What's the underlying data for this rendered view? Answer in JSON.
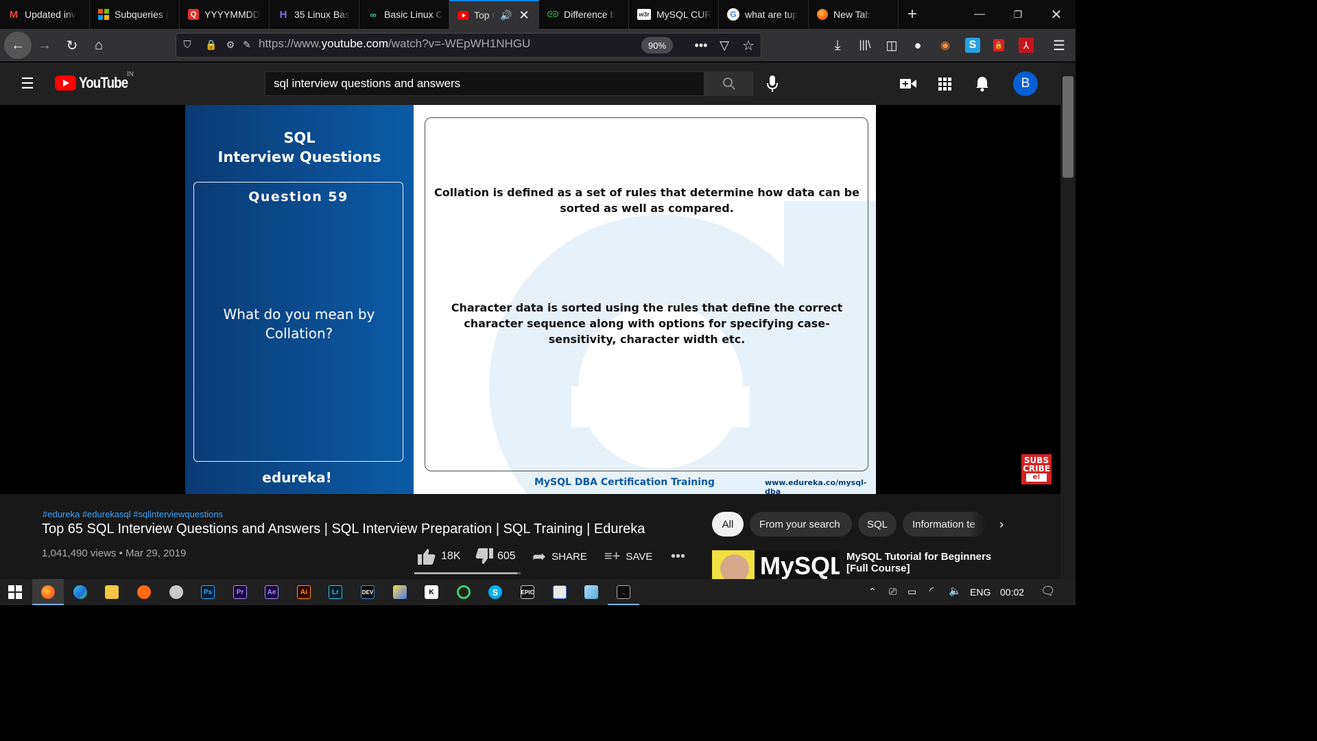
{
  "browser": {
    "tabs": [
      {
        "label": "Updated inv",
        "icon": "gmail-icon",
        "active": false
      },
      {
        "label": "Subqueries (",
        "icon": "microsoft-icon",
        "active": false
      },
      {
        "label": "YYYYMMDD",
        "icon": "page-icon",
        "active": false
      },
      {
        "label": "35 Linux Bas",
        "icon": "site-icon",
        "active": false
      },
      {
        "label": "Basic Linux C",
        "icon": "site-icon",
        "active": false
      },
      {
        "label": "Top 6",
        "icon": "youtube-icon",
        "active": true
      },
      {
        "label": "Difference b",
        "icon": "gfg-icon",
        "active": false
      },
      {
        "label": "MySQL CUR",
        "icon": "w3schools-icon",
        "active": false
      },
      {
        "label": "what are tup",
        "icon": "google-icon",
        "active": false
      },
      {
        "label": "New Tab",
        "icon": "firefox-icon",
        "active": false
      }
    ],
    "url_prefix": "https://www.",
    "url_domain": "youtube.com",
    "url_path": "/watch?v=-WEpWH1NHGU",
    "zoom": "90%"
  },
  "youtube": {
    "logo_text": "YouTube",
    "region": "IN",
    "search_value": "sql interview questions and answers",
    "avatar_letter": "B"
  },
  "slide": {
    "left_title_1": "SQL",
    "left_title_2": "Interview Questions",
    "question_label": "Question 59",
    "question_text": "What do you mean by Collation?",
    "brand": "edureka!",
    "answer_1": "Collation is defined as a set of rules that determine how data can be sorted as well as compared.",
    "answer_2": "Character data is sorted using the rules that define the correct character sequence along with options for specifying case-sensitivity, character width etc.",
    "footer_course": "MySQL DBA Certification Training",
    "footer_url": "www.edureka.co/mysql-dba",
    "subscribe_1": "SUBS",
    "subscribe_2": "CRIBE",
    "subscribe_3": "e!"
  },
  "video": {
    "hashtags": "#edureka #edurekasql #sqlinterviewquestions",
    "title": "Top 65 SQL Interview Questions and Answers | SQL Interview Preparation | SQL Training | Edureka",
    "views": "1,041,490 views",
    "date": "Mar 29, 2019",
    "likes": "18K",
    "like_fraction": 0.97,
    "dislikes": "605",
    "share_label": "SHARE",
    "save_label": "SAVE"
  },
  "chips": [
    "All",
    "From your search",
    "SQL",
    "Information te"
  ],
  "recommended": {
    "thumb_text": "MySQL",
    "title_1": "MySQL Tutorial for Beginners",
    "title_2": "[Full Course]"
  },
  "taskbar": {
    "language": "ENG",
    "time": "00:02"
  }
}
